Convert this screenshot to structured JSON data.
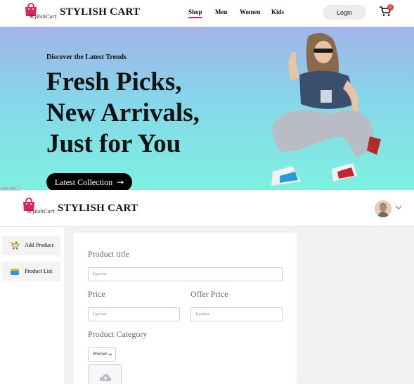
{
  "store_nav": {
    "logo_text": "StylishCart",
    "brand": "STYLISH CART",
    "links": [
      "Shop",
      "Men",
      "Women",
      "Kids"
    ],
    "active_link": "Shop",
    "login_label": "Login",
    "cart_count": "0",
    "icons": {
      "logo": "shopping-bag-logo",
      "cart": "cart-icon"
    }
  },
  "hero": {
    "kicker": "Discover the Latest Trends",
    "headline": [
      "Fresh Picks,",
      "New Arrivals,",
      "Just for You"
    ],
    "cta_label": "Latest Collection",
    "cta_icon": "arrow-right-icon",
    "corner_tag": "Lykon 2022",
    "colors": {
      "gradient_top": "#a4b3e9",
      "gradient_bottom": "#7ef1e1"
    }
  },
  "admin_header": {
    "logo_text": "StylishCart",
    "brand": "STYLISH CART",
    "icons": {
      "avatar": "user-avatar",
      "menu": "chevron-down-icon"
    }
  },
  "sidebar": {
    "items": [
      {
        "label": "Add Product",
        "icon": "add-to-cart-icon"
      },
      {
        "label": "Product List",
        "icon": "product-list-icon"
      }
    ]
  },
  "product_form": {
    "title_label": "Product title",
    "title_placeholder": "Type here",
    "price_label": "Price",
    "price_placeholder": "Type here",
    "offer_price_label": "Offer Price",
    "offer_price_placeholder": "Type here",
    "category_label": "Product Category",
    "category_value": "Women",
    "upload_icon": "upload-cloud-icon"
  },
  "colors": {
    "accent": "#e0245e",
    "cart_badge": "#e53935"
  }
}
